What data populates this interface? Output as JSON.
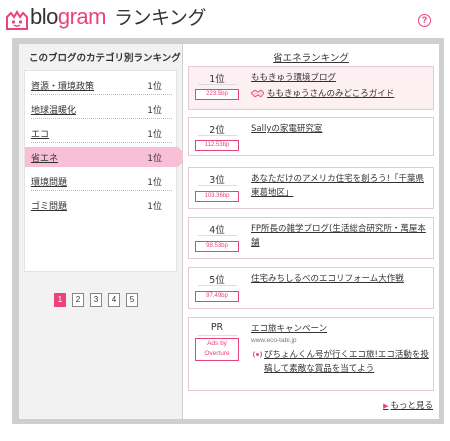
{
  "header": {
    "logo_part1": "blo",
    "logo_part2": "gram",
    "logo_part3": "ランキング",
    "help_icon": "?"
  },
  "colors": {
    "accent": "#e8447a",
    "active_category": "#f8bfd6",
    "frame": "#cfcfcf",
    "left_panel": "#f2f2f2"
  },
  "left": {
    "title": "このブログのカテゴリ別ランキング",
    "categories": [
      {
        "name": "資源・環境政策",
        "rank": "1位"
      },
      {
        "name": "地球温暖化",
        "rank": "1位"
      },
      {
        "name": "エコ",
        "rank": "1位"
      },
      {
        "name": "省エネ",
        "rank": "1位"
      },
      {
        "name": "環境問題",
        "rank": "1位"
      },
      {
        "name": "ゴミ問題",
        "rank": "1位"
      }
    ],
    "active_index": 3,
    "pages": [
      "1",
      "2",
      "3",
      "4",
      "5"
    ],
    "active_page": 0
  },
  "right": {
    "title": "省エネランキング",
    "entries": [
      {
        "rank": "1位",
        "score": "223.5bp",
        "title": "ももきゅう環境ブログ",
        "owner": "ももきゅうさんのみどころガイド",
        "owner_icon": "handshake-icon"
      },
      {
        "rank": "2位",
        "score": "112.53bp",
        "title": "Sallyの家電研究室"
      },
      {
        "rank": "3位",
        "score": "103.36bp",
        "title": "あなただけのアメリカ住宅を創ろう!「千葉県東葛地区」"
      },
      {
        "rank": "4位",
        "score": "98.53bp",
        "title": "FP所長の雑学ブログ(生活総合研究所・萬屋本舗"
      },
      {
        "rank": "5位",
        "score": "97.49bp",
        "title": "住宅みちしるべのエコリフォーム大作戦"
      }
    ],
    "pr": {
      "label": "PR",
      "badge_line1": "Ads by",
      "badge_line2": "Overture",
      "title": "エコ旅キャンペーン",
      "url": "www.eco-tabi.jp",
      "icon": "radio-wave-icon",
      "description": "ぴちょんくん号が行くエコ旅!エコ活動を投稿して素敵な賞品を当てよう"
    },
    "more": "もっと見る"
  }
}
